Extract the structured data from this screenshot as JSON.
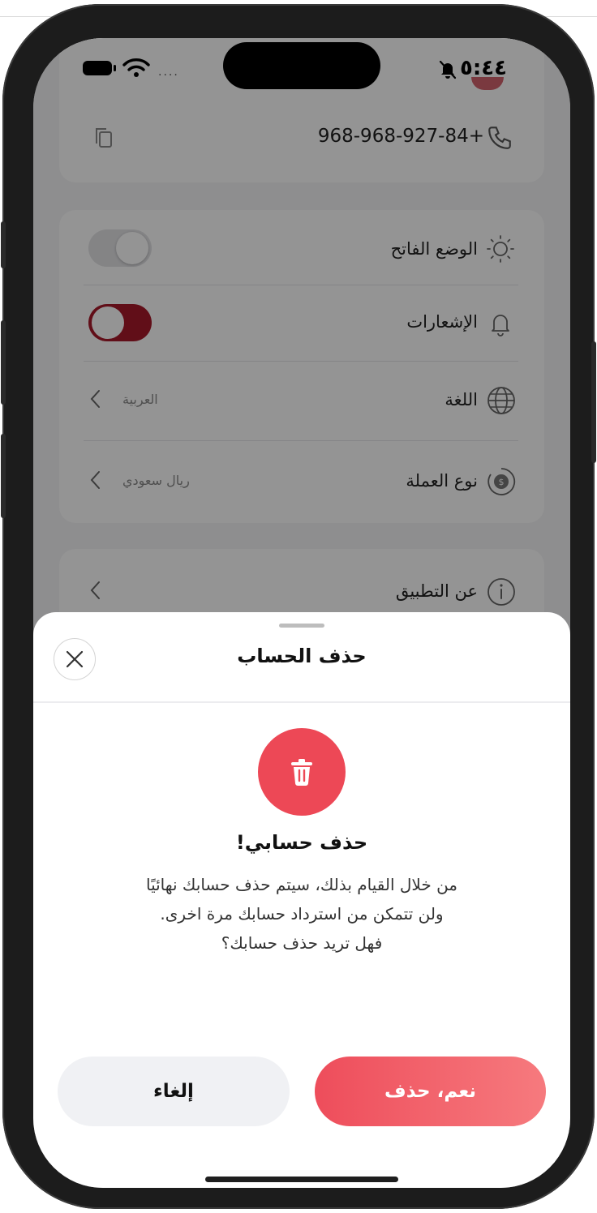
{
  "status_bar": {
    "time": "٥:٤٤",
    "icons": [
      "battery-icon",
      "wifi-icon",
      "bell-muted-icon"
    ]
  },
  "profile": {
    "phone": "968-968-927-84+"
  },
  "settings": {
    "light_mode": {
      "label": "الوضع الفاتح",
      "enabled": false
    },
    "notifications": {
      "label": "الإشعارات",
      "enabled": true
    },
    "language": {
      "label": "اللغة",
      "value": "العربية"
    },
    "currency": {
      "label": "نوع العملة",
      "value": "ريال سعودي"
    },
    "about": {
      "label": "عن التطبيق"
    }
  },
  "sheet": {
    "title": "حذف الحساب",
    "heading": "حذف حسابي!",
    "message_lines": [
      "من خلال القيام بذلك، سيتم حذف حسابك نهائيًا",
      "ولن تتمكن من استرداد حسابك مرة اخرى.",
      "فهل تريد حذف حسابك؟"
    ],
    "confirm_label": "نعم، حذف",
    "cancel_label": "إلغاء"
  },
  "colors": {
    "accent": "#ed4856",
    "toggle_on": "#a8192a"
  }
}
